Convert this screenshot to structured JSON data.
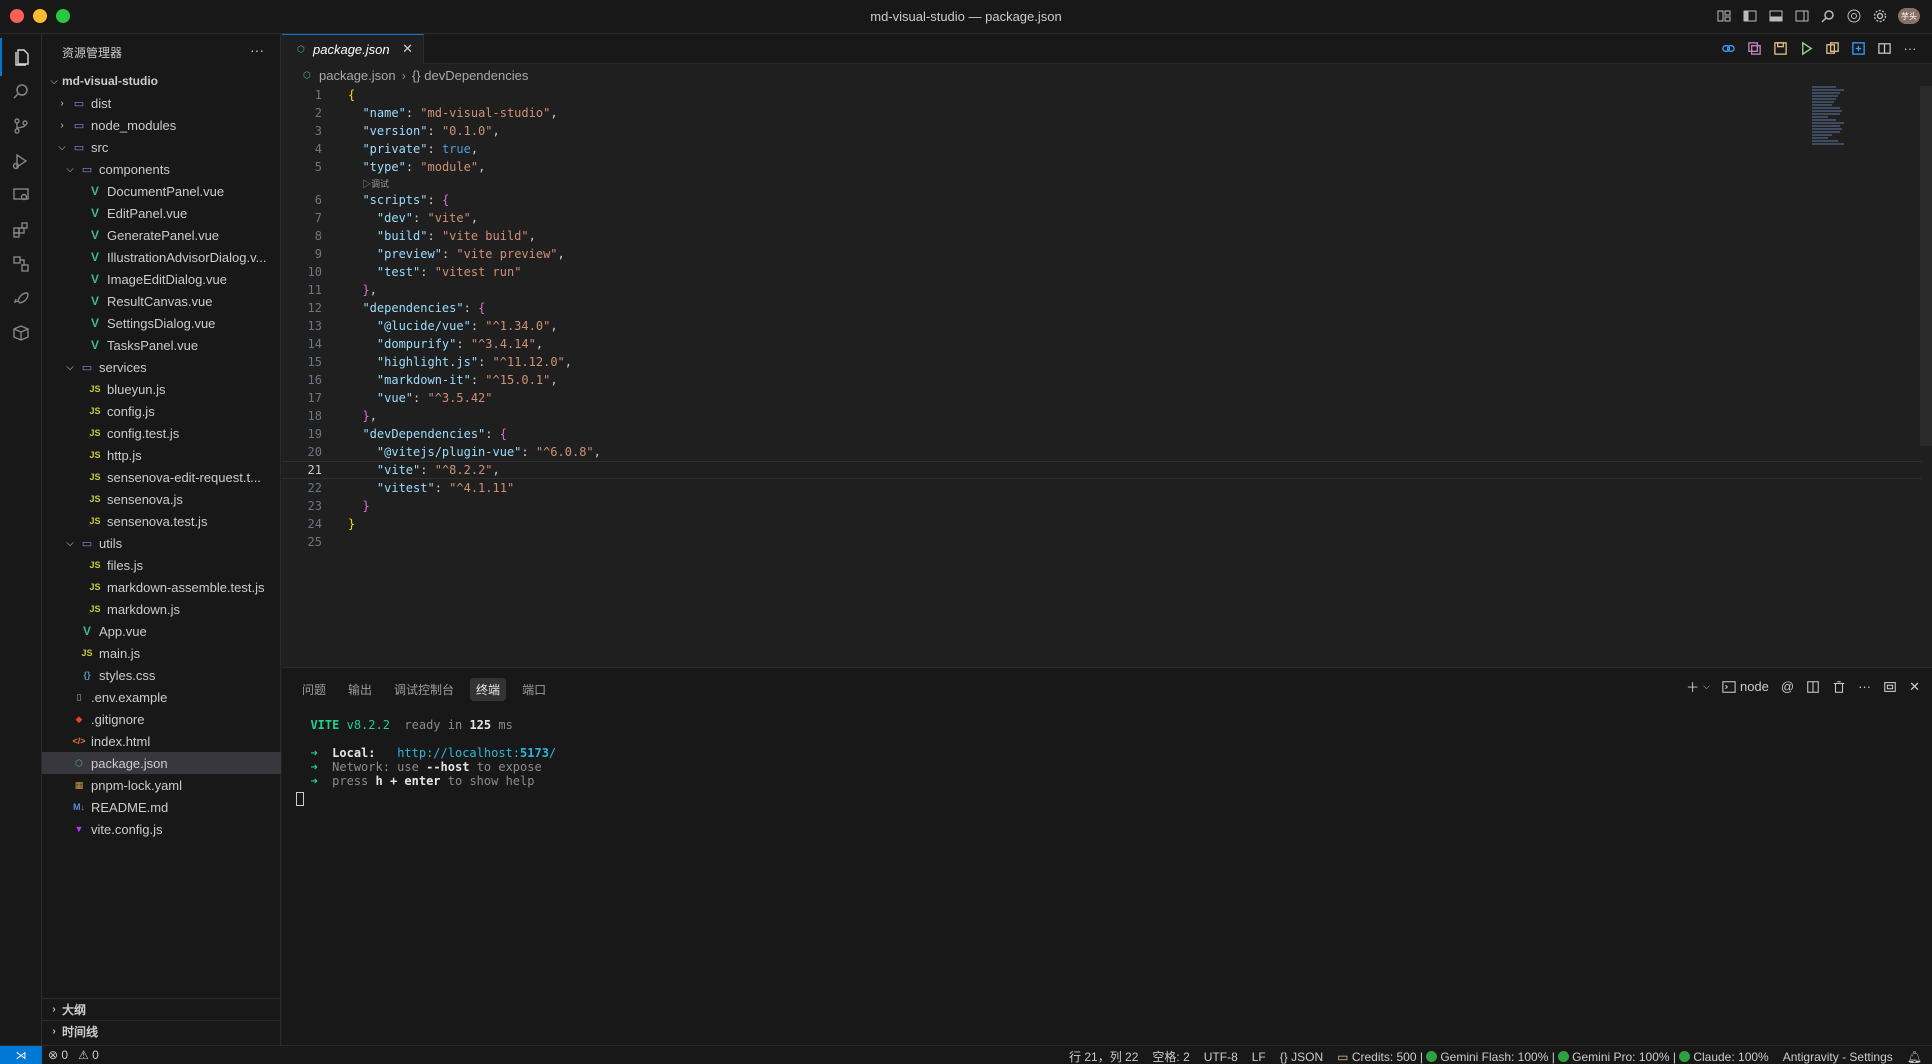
{
  "window": {
    "title": "md-visual-studio — package.json",
    "avatar_text": "芋头"
  },
  "activity_bar": {
    "items": [
      "files-icon",
      "search-icon",
      "source-control-icon",
      "run-debug-icon",
      "remote-explorer-icon",
      "extensions-icon",
      "antigravity-icon",
      "rocket-icon",
      "container-icon"
    ],
    "active": "files-icon"
  },
  "sidebar": {
    "title": "资源管理器",
    "root": "md-visual-studio",
    "tree": [
      {
        "label": "dist",
        "type": "folder",
        "depth": 1,
        "expanded": false
      },
      {
        "label": "node_modules",
        "type": "folder",
        "depth": 1,
        "expanded": false
      },
      {
        "label": "src",
        "type": "folder",
        "depth": 1,
        "expanded": true
      },
      {
        "label": "components",
        "type": "folder",
        "depth": 2,
        "expanded": true
      },
      {
        "label": "DocumentPanel.vue",
        "type": "vue",
        "depth": 3
      },
      {
        "label": "EditPanel.vue",
        "type": "vue",
        "depth": 3
      },
      {
        "label": "GeneratePanel.vue",
        "type": "vue",
        "depth": 3
      },
      {
        "label": "IllustrationAdvisorDialog.v...",
        "type": "vue",
        "depth": 3
      },
      {
        "label": "ImageEditDialog.vue",
        "type": "vue",
        "depth": 3
      },
      {
        "label": "ResultCanvas.vue",
        "type": "vue",
        "depth": 3
      },
      {
        "label": "SettingsDialog.vue",
        "type": "vue",
        "depth": 3
      },
      {
        "label": "TasksPanel.vue",
        "type": "vue",
        "depth": 3
      },
      {
        "label": "services",
        "type": "folder",
        "depth": 2,
        "expanded": true
      },
      {
        "label": "blueyun.js",
        "type": "js",
        "depth": 3
      },
      {
        "label": "config.js",
        "type": "js",
        "depth": 3
      },
      {
        "label": "config.test.js",
        "type": "js",
        "depth": 3
      },
      {
        "label": "http.js",
        "type": "js",
        "depth": 3
      },
      {
        "label": "sensenova-edit-request.t...",
        "type": "js",
        "depth": 3
      },
      {
        "label": "sensenova.js",
        "type": "js",
        "depth": 3
      },
      {
        "label": "sensenova.test.js",
        "type": "js",
        "depth": 3
      },
      {
        "label": "utils",
        "type": "folder",
        "depth": 2,
        "expanded": true
      },
      {
        "label": "files.js",
        "type": "js",
        "depth": 3
      },
      {
        "label": "markdown-assemble.test.js",
        "type": "js",
        "depth": 3
      },
      {
        "label": "markdown.js",
        "type": "js",
        "depth": 3
      },
      {
        "label": "App.vue",
        "type": "vue",
        "depth": 2
      },
      {
        "label": "main.js",
        "type": "js",
        "depth": 2
      },
      {
        "label": "styles.css",
        "type": "css",
        "depth": 2
      },
      {
        "label": ".env.example",
        "type": "env",
        "depth": 1
      },
      {
        "label": ".gitignore",
        "type": "git",
        "depth": 1
      },
      {
        "label": "index.html",
        "type": "html",
        "depth": 1
      },
      {
        "label": "package.json",
        "type": "json",
        "depth": 1,
        "selected": true
      },
      {
        "label": "pnpm-lock.yaml",
        "type": "yaml",
        "depth": 1
      },
      {
        "label": "README.md",
        "type": "md",
        "depth": 1
      },
      {
        "label": "vite.config.js",
        "type": "vite",
        "depth": 1
      }
    ],
    "outline_label": "大纲",
    "timeline_label": "时间线"
  },
  "editor": {
    "tab_label": "package.json",
    "breadcrumb": [
      "package.json",
      "{} devDependencies"
    ],
    "codelens": "▷调试",
    "current_line": 21,
    "lines": [
      [
        [
          "br1",
          "{"
        ]
      ],
      [
        [
          "p",
          "  "
        ],
        [
          "k",
          "\"name\""
        ],
        [
          "p",
          ": "
        ],
        [
          "s",
          "\"md-visual-studio\""
        ],
        [
          "p",
          ","
        ]
      ],
      [
        [
          "p",
          "  "
        ],
        [
          "k",
          "\"version\""
        ],
        [
          "p",
          ": "
        ],
        [
          "s",
          "\"0.1.0\""
        ],
        [
          "p",
          ","
        ]
      ],
      [
        [
          "p",
          "  "
        ],
        [
          "k",
          "\"private\""
        ],
        [
          "p",
          ": "
        ],
        [
          "b",
          "true"
        ],
        [
          "p",
          ","
        ]
      ],
      [
        [
          "p",
          "  "
        ],
        [
          "k",
          "\"type\""
        ],
        [
          "p",
          ": "
        ],
        [
          "s",
          "\"module\""
        ],
        [
          "p",
          ","
        ]
      ],
      [
        [
          "p",
          "  "
        ],
        [
          "k",
          "\"scripts\""
        ],
        [
          "p",
          ": "
        ],
        [
          "br2",
          "{"
        ]
      ],
      [
        [
          "p",
          "    "
        ],
        [
          "k",
          "\"dev\""
        ],
        [
          "p",
          ": "
        ],
        [
          "s",
          "\"vite\""
        ],
        [
          "p",
          ","
        ]
      ],
      [
        [
          "p",
          "    "
        ],
        [
          "k",
          "\"build\""
        ],
        [
          "p",
          ": "
        ],
        [
          "s",
          "\"vite build\""
        ],
        [
          "p",
          ","
        ]
      ],
      [
        [
          "p",
          "    "
        ],
        [
          "k",
          "\"preview\""
        ],
        [
          "p",
          ": "
        ],
        [
          "s",
          "\"vite preview\""
        ],
        [
          "p",
          ","
        ]
      ],
      [
        [
          "p",
          "    "
        ],
        [
          "k",
          "\"test\""
        ],
        [
          "p",
          ": "
        ],
        [
          "s",
          "\"vitest run\""
        ]
      ],
      [
        [
          "p",
          "  "
        ],
        [
          "br2",
          "}"
        ],
        [
          "p",
          ","
        ]
      ],
      [
        [
          "p",
          "  "
        ],
        [
          "k",
          "\"dependencies\""
        ],
        [
          "p",
          ": "
        ],
        [
          "br2",
          "{"
        ]
      ],
      [
        [
          "p",
          "    "
        ],
        [
          "k",
          "\"@lucide/vue\""
        ],
        [
          "p",
          ": "
        ],
        [
          "s",
          "\"^1.34.0\""
        ],
        [
          "p",
          ","
        ]
      ],
      [
        [
          "p",
          "    "
        ],
        [
          "k",
          "\"dompurify\""
        ],
        [
          "p",
          ": "
        ],
        [
          "s",
          "\"^3.4.14\""
        ],
        [
          "p",
          ","
        ]
      ],
      [
        [
          "p",
          "    "
        ],
        [
          "k",
          "\"highlight.js\""
        ],
        [
          "p",
          ": "
        ],
        [
          "s",
          "\"^11.12.0\""
        ],
        [
          "p",
          ","
        ]
      ],
      [
        [
          "p",
          "    "
        ],
        [
          "k",
          "\"markdown-it\""
        ],
        [
          "p",
          ": "
        ],
        [
          "s",
          "\"^15.0.1\""
        ],
        [
          "p",
          ","
        ]
      ],
      [
        [
          "p",
          "    "
        ],
        [
          "k",
          "\"vue\""
        ],
        [
          "p",
          ": "
        ],
        [
          "s",
          "\"^3.5.42\""
        ]
      ],
      [
        [
          "p",
          "  "
        ],
        [
          "br2",
          "}"
        ],
        [
          "p",
          ","
        ]
      ],
      [
        [
          "p",
          "  "
        ],
        [
          "k",
          "\"devDependencies\""
        ],
        [
          "p",
          ": "
        ],
        [
          "br2",
          "{"
        ]
      ],
      [
        [
          "p",
          "    "
        ],
        [
          "k",
          "\"@vitejs/plugin-vue\""
        ],
        [
          "p",
          ": "
        ],
        [
          "s",
          "\"^6.0.8\""
        ],
        [
          "p",
          ","
        ]
      ],
      [
        [
          "p",
          "    "
        ],
        [
          "k",
          "\"vite\""
        ],
        [
          "p",
          ": "
        ],
        [
          "s",
          "\"^8.2.2\""
        ],
        [
          "p",
          ","
        ]
      ],
      [
        [
          "p",
          "    "
        ],
        [
          "k",
          "\"vitest\""
        ],
        [
          "p",
          ": "
        ],
        [
          "s",
          "\"^4.1.11\""
        ]
      ],
      [
        [
          "p",
          "  "
        ],
        [
          "br2",
          "}"
        ]
      ],
      [
        [
          "br1",
          "}"
        ]
      ],
      []
    ]
  },
  "panel": {
    "tabs": [
      "问题",
      "输出",
      "调试控制台",
      "终端",
      "端口"
    ],
    "active_tab": "终端",
    "terminal_name": "node",
    "terminal": {
      "vite": "VITE",
      "version": "v8.2.2",
      "ready_in": "ready in",
      "ready_ms": "125",
      "ms_unit": "ms",
      "arrow": "➜",
      "local_label": "Local:",
      "local_url_prefix": "http://localhost:",
      "local_url_port": "5173",
      "local_url_suffix": "/",
      "network_label": "Network:",
      "network_use": "use",
      "network_flag": "--host",
      "network_tail": "to expose",
      "help_press": "press",
      "help_keys": "h + enter",
      "help_tail": "to show help"
    }
  },
  "statusbar": {
    "errors": "0",
    "warnings": "0",
    "position": "行 21，列 22",
    "spaces": "空格: 2",
    "encoding": "UTF-8",
    "eol": "LF",
    "language": "{} JSON",
    "credits": "Credits: 500 |",
    "gemini_flash": "Gemini Flash: 100% |",
    "gemini_pro": "Gemini Pro: 100% |",
    "claude": "Claude: 100%",
    "settings": "Antigravity - Settings"
  }
}
